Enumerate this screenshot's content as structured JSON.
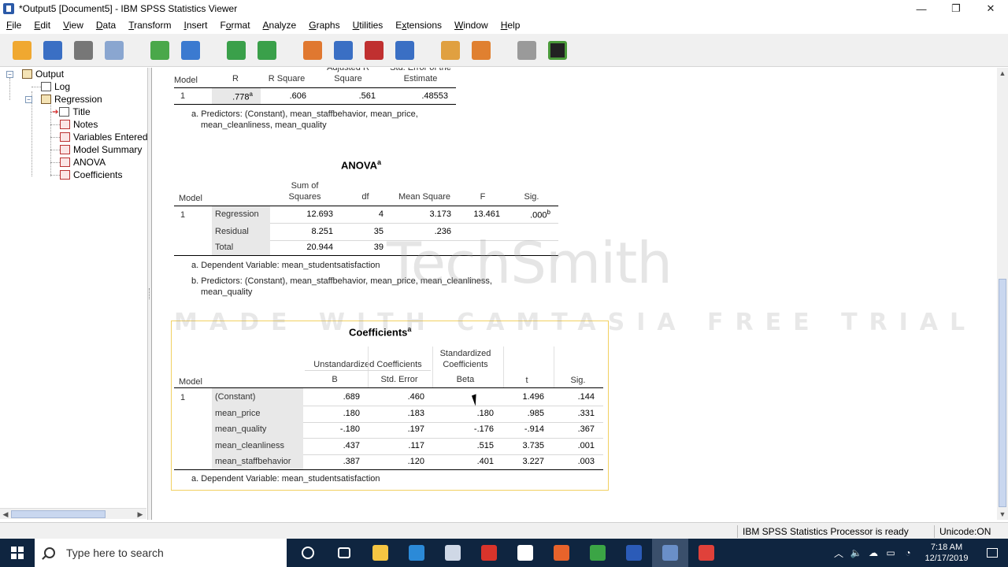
{
  "window": {
    "title": "*Output5 [Document5] - IBM SPSS Statistics Viewer",
    "controls": [
      "—",
      "❐",
      "✕"
    ]
  },
  "menu": [
    {
      "label": "File",
      "u": "F",
      "rest": "ile"
    },
    {
      "label": "Edit",
      "u": "E",
      "rest": "dit"
    },
    {
      "label": "View",
      "u": "V",
      "rest": "iew"
    },
    {
      "label": "Data",
      "u": "D",
      "rest": "ata"
    },
    {
      "label": "Transform",
      "u": "T",
      "rest": "ransform"
    },
    {
      "label": "Insert",
      "u": "I",
      "rest": "nsert"
    },
    {
      "label": "Format",
      "u": "o",
      "pre": "F",
      "rest": "rmat"
    },
    {
      "label": "Analyze",
      "u": "A",
      "rest": "nalyze"
    },
    {
      "label": "Graphs",
      "u": "G",
      "rest": "raphs"
    },
    {
      "label": "Utilities",
      "u": "U",
      "rest": "tilities"
    },
    {
      "label": "Extensions",
      "u": "x",
      "pre": "E",
      "rest": "tensions"
    },
    {
      "label": "Window",
      "u": "W",
      "rest": "indow"
    },
    {
      "label": "Help",
      "u": "H",
      "rest": "elp"
    }
  ],
  "toolbar_icons": [
    {
      "name": "open-icon",
      "color": "#f0a830"
    },
    {
      "name": "save-icon",
      "color": "#3a6fc4"
    },
    {
      "name": "print-icon",
      "color": "#777777"
    },
    {
      "name": "print-preview-icon",
      "color": "#8aa6d0"
    },
    {
      "name": "export-icon",
      "color": "#4aa84a"
    },
    {
      "name": "recall-dialog-icon",
      "color": "#3b7ad0"
    },
    {
      "name": "undo-icon",
      "color": "#3aa04a"
    },
    {
      "name": "redo-icon",
      "color": "#3aa04a"
    },
    {
      "name": "goto-data-icon",
      "color": "#e07830"
    },
    {
      "name": "goto-case-icon",
      "color": "#3a6fc4"
    },
    {
      "name": "goto-variable-icon",
      "color": "#c03030"
    },
    {
      "name": "variables-icon",
      "color": "#3a6fc4"
    },
    {
      "name": "designate-window-icon",
      "color": "#e0a040"
    },
    {
      "name": "select-last-output-icon",
      "color": "#e08030"
    },
    {
      "name": "show-all-icon",
      "color": "#9a9a9a"
    },
    {
      "name": "add-icon",
      "color": "#4a9a3a"
    }
  ],
  "nav": {
    "output": "Output",
    "log": "Log",
    "regression": "Regression",
    "items": [
      "Title",
      "Notes",
      "Variables Entered",
      "Model Summary",
      "ANOVA",
      "Coefficients"
    ]
  },
  "model_summary": {
    "headers": {
      "model": "Model",
      "r": "R",
      "r_square": "R Square",
      "adj_r_square": "Adjusted R Square",
      "std_error": "Std. Error of the Estimate"
    },
    "row": {
      "model": "1",
      "r": ".778",
      "r_sup": "a",
      "r_square": ".606",
      "adj": ".561",
      "se": ".48553"
    },
    "footnote_a": "a. Predictors: (Constant), mean_staffbehavior, mean_price,",
    "footnote_a2": "mean_cleanliness, mean_quality"
  },
  "anova": {
    "title": "ANOVA",
    "title_sup": "a",
    "headers": {
      "model": "Model",
      "ss": "Sum of Squares",
      "df": "df",
      "ms": "Mean Square",
      "f": "F",
      "sig": "Sig."
    },
    "model": "1",
    "rows": [
      {
        "label": "Regression",
        "ss": "12.693",
        "df": "4",
        "ms": "3.173",
        "f": "13.461",
        "sig": ".000",
        "sig_sup": "b"
      },
      {
        "label": "Residual",
        "ss": "8.251",
        "df": "35",
        "ms": ".236",
        "f": "",
        "sig": "",
        "sig_sup": ""
      },
      {
        "label": "Total",
        "ss": "20.944",
        "df": "39",
        "ms": "",
        "f": "",
        "sig": "",
        "sig_sup": ""
      }
    ],
    "footnote_a": "a. Dependent Variable: mean_studentsatisfaction",
    "footnote_b": "b. Predictors: (Constant), mean_staffbehavior, mean_price, mean_cleanliness,",
    "footnote_b2": "mean_quality"
  },
  "coefficients": {
    "title": "Coefficients",
    "title_sup": "a",
    "headers": {
      "model": "Model",
      "unstd": "Unstandardized Coefficients",
      "std": "Standardized Coefficients",
      "b": "B",
      "se": "Std. Error",
      "beta": "Beta",
      "t": "t",
      "sig": "Sig."
    },
    "model": "1",
    "rows": [
      {
        "label": "(Constant)",
        "b": ".689",
        "se": ".460",
        "beta": "",
        "t": "1.496",
        "sig": ".144"
      },
      {
        "label": "mean_price",
        "b": ".180",
        "se": ".183",
        "beta": ".180",
        "t": ".985",
        "sig": ".331"
      },
      {
        "label": "mean_quality",
        "b": "-.180",
        "se": ".197",
        "beta": "-.176",
        "t": "-.914",
        "sig": ".367"
      },
      {
        "label": "mean_cleanliness",
        "b": ".437",
        "se": ".117",
        "beta": ".515",
        "t": "3.735",
        "sig": ".001"
      },
      {
        "label": "mean_staffbehavior",
        "b": ".387",
        "se": ".120",
        "beta": ".401",
        "t": "3.227",
        "sig": ".003"
      }
    ],
    "footnote_a": "a. Dependent Variable: mean_studentsatisfaction"
  },
  "watermark": {
    "line1": "TechSmith",
    "line2": "MADE WITH CAMTASIA FREE TRIAL"
  },
  "status": {
    "processor": "IBM SPSS Statistics Processor is ready",
    "unicode": "Unicode:ON"
  },
  "taskbar": {
    "search_placeholder": "Type here to search",
    "apps": [
      {
        "name": "cortana-icon",
        "color": "#ffffff"
      },
      {
        "name": "task-view-icon",
        "color": "#ffffff"
      },
      {
        "name": "file-explorer-icon",
        "color": "#f5c542"
      },
      {
        "name": "edge-icon",
        "color": "#2b8ad8"
      },
      {
        "name": "store-icon",
        "color": "#cfd8e6"
      },
      {
        "name": "gift-icon",
        "color": "#d9342b"
      },
      {
        "name": "mail-icon",
        "color": "#ffffff"
      },
      {
        "name": "firefox-icon",
        "color": "#e8632b"
      },
      {
        "name": "camtasia-recorder-icon",
        "color": "#3ba545"
      },
      {
        "name": "word-icon",
        "color": "#2b5bb8"
      },
      {
        "name": "spss-icon",
        "color": "#6a8fc8"
      },
      {
        "name": "camtasia-icon",
        "color": "#e0413a"
      }
    ],
    "time": "7:18 AM",
    "date": "12/17/2019"
  }
}
